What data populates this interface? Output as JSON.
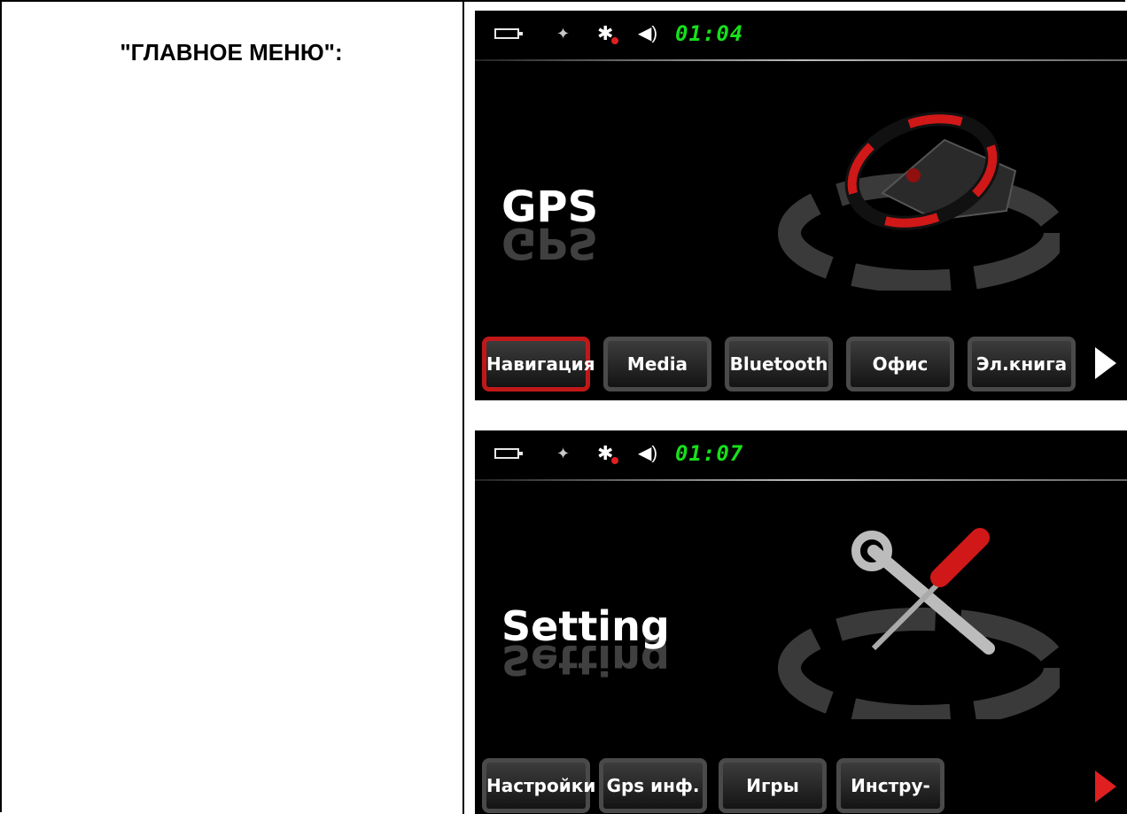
{
  "left_panel": {
    "title": "\"ГЛАВНОЕ МЕНЮ\":"
  },
  "screens": [
    {
      "clock": "01:04",
      "big_title": "GPS",
      "icons": [
        "battery-icon",
        "satellite-icon",
        "bluetooth-off-icon",
        "speaker-icon",
        "steering-wheel-icon",
        "next-arrow-icon"
      ],
      "buttons": [
        {
          "label": "Навигация",
          "active": true
        },
        {
          "label": "Media"
        },
        {
          "label": "Bluetooth"
        },
        {
          "label": "Офис"
        },
        {
          "label": "Эл.книга"
        }
      ],
      "arrow_color": "#ffffff"
    },
    {
      "clock": "01:07",
      "big_title": "Setting",
      "icons": [
        "battery-icon",
        "satellite-icon",
        "bluetooth-off-icon",
        "speaker-icon",
        "tools-icon",
        "next-arrow-icon"
      ],
      "buttons": [
        {
          "label": "Настройки"
        },
        {
          "label": "Gps инф."
        },
        {
          "label": "Игры"
        },
        {
          "label": "Инстру-ты"
        }
      ],
      "arrow_color": "#e02020"
    }
  ],
  "colors": {
    "clock": "#17e01b",
    "accent_red": "#c01818",
    "background": "#000000"
  }
}
